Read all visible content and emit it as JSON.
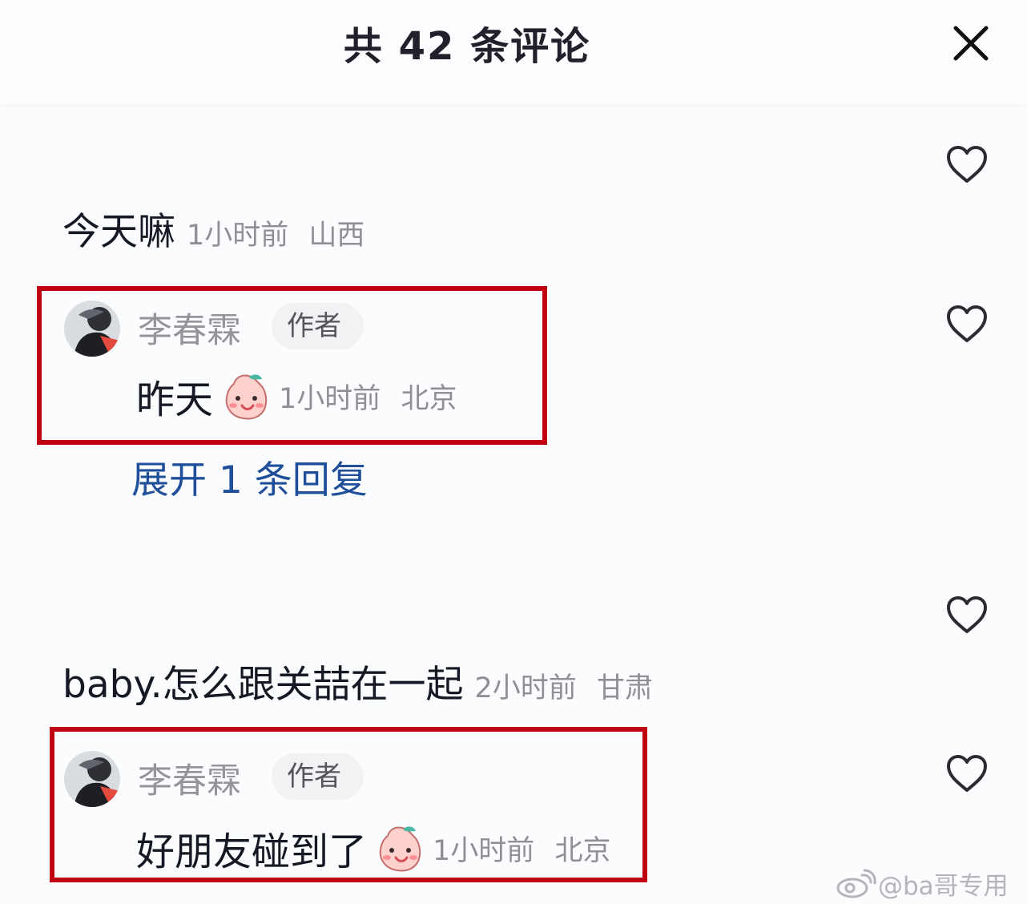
{
  "header": {
    "title": "共 42 条评论"
  },
  "comments": [
    {
      "text": "今天嘛",
      "time": "1小时前",
      "location": "山西",
      "heart_icon": "heart-outline-icon",
      "reply": {
        "author": "李春霖",
        "badge": "作者",
        "text": "昨天",
        "emoji": "smiling-face-sticker",
        "time": "1小时前",
        "location": "北京"
      }
    },
    {
      "text": "baby.怎么跟关喆在一起",
      "time": "2小时前",
      "location": "甘肃",
      "heart_icon": "heart-outline-icon",
      "reply": {
        "author": "李春霖",
        "badge": "作者",
        "text": "好朋友碰到了",
        "emoji": "smiling-face-sticker",
        "time": "1小时前",
        "location": "北京"
      }
    }
  ],
  "expand_replies": "展开 1 条回复",
  "watermark": "@ba哥专用",
  "colors": {
    "highlight_border": "#c00012",
    "link": "#1f4f9a",
    "meta": "#8f9095",
    "background": "#fbfcfe"
  },
  "icons": {
    "close": "close-icon",
    "like": "heart-icon",
    "watermark_logo": "weibo-icon"
  }
}
